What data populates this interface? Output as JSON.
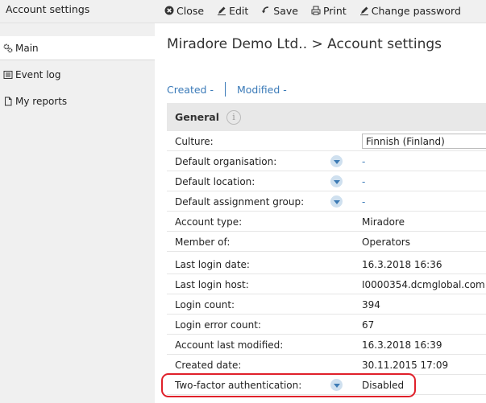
{
  "app": {
    "title": "Account settings"
  },
  "toolbar": {
    "close_label": "Close",
    "edit_label": "Edit",
    "save_label": "Save",
    "print_label": "Print",
    "change_password_label": "Change password"
  },
  "sidebar": {
    "items": [
      {
        "label": "Main",
        "icon": "gears-icon",
        "active": true
      },
      {
        "label": "Event log",
        "icon": "list-icon"
      },
      {
        "label": "My reports",
        "icon": "document-icon"
      }
    ]
  },
  "page": {
    "title": "Miradore Demo Ltd.. > Account settings",
    "created_label": "Created -",
    "modified_label": "Modified -"
  },
  "general": {
    "title": "General",
    "info_glyph": "i",
    "rows": [
      {
        "label": "Culture:",
        "value": "Finnish (Finland)"
      },
      {
        "label": "Default organisation:",
        "value": "-"
      },
      {
        "label": "Default location:",
        "value": "-"
      },
      {
        "label": "Default assignment group:",
        "value": "-"
      },
      {
        "label": "Account type:",
        "value": "Miradore"
      },
      {
        "label": "Member of:",
        "value": "Operators"
      },
      {
        "label": "Last login date:",
        "value": "16.3.2018 16:36"
      },
      {
        "label": "Last login host:",
        "value": "I0000354.dcmglobal.com"
      },
      {
        "label": "Login count:",
        "value": "394"
      },
      {
        "label": "Login error count:",
        "value": "67"
      },
      {
        "label": "Account last modified:",
        "value": "16.3.2018 16:39"
      },
      {
        "label": "Created date:",
        "value": "30.11.2015 17:09"
      },
      {
        "label": "Two-factor authentication:",
        "value": "Disabled"
      }
    ]
  },
  "colors": {
    "accent_link": "#3a7ab8",
    "highlight": "#e0202a",
    "sidebar_bg": "#f0f0f0"
  }
}
